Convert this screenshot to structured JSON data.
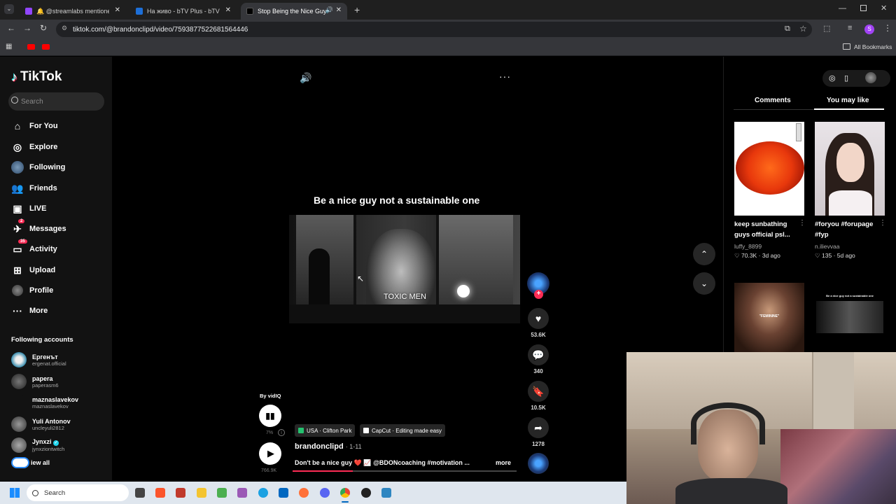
{
  "browser": {
    "tabs": [
      {
        "title": "🔔 @streamlabs mentioned yo",
        "fav_color": "#9146ff"
      },
      {
        "title": "На живо - bTV Plus - bTV+",
        "fav_color": "#1d6fd8"
      },
      {
        "title": "Stop Being the Nice Guy: E",
        "fav_color": "#000000"
      }
    ],
    "url": "tiktok.com/@brandonclipd/video/7593877522681564446",
    "bookmarks_label": "All Bookmarks",
    "profile_initial": "S"
  },
  "tiktok": {
    "logo": "TikTok",
    "search_placeholder": "Search",
    "nav": [
      {
        "label": "For You",
        "icon": "home-icon"
      },
      {
        "label": "Explore",
        "icon": "compass-icon"
      },
      {
        "label": "Following",
        "icon": "following-avatar-icon"
      },
      {
        "label": "Friends",
        "icon": "friends-icon"
      },
      {
        "label": "LIVE",
        "icon": "live-icon"
      },
      {
        "label": "Messages",
        "icon": "messages-icon",
        "badge": "2"
      },
      {
        "label": "Activity",
        "icon": "activity-icon",
        "badge": "35"
      },
      {
        "label": "Upload",
        "icon": "upload-icon"
      },
      {
        "label": "Profile",
        "icon": "profile-icon"
      },
      {
        "label": "More",
        "icon": "more-icon"
      }
    ],
    "following_heading": "Following accounts",
    "following": [
      {
        "name": "Ергенът",
        "handle": "ergenat.official"
      },
      {
        "name": "papera",
        "handle": "paperasm6"
      },
      {
        "name": "maznaslavekov",
        "handle": "maznaslavekov"
      },
      {
        "name": "Yuli Antonov",
        "handle": "uncleyuli2812"
      },
      {
        "name": "Jynxzi",
        "handle": "jynxziontwitch"
      }
    ],
    "see_all": "iew all"
  },
  "video": {
    "headline": "Be a nice guy not a sustainable one",
    "overlay_text": "TOXIC MEN",
    "by_label": "By vidIQ",
    "vidiq_pct": "7%",
    "views": "766.9K",
    "location_tag": "USA · Clifton Park",
    "capcut_tag": "CapCut · Editing made easy",
    "author": "brandonclipd",
    "date": "· 1-11",
    "description": "Don't be a nice guy ❤️ 📈 @BDONcoaching #motivation ...",
    "more_label": "more",
    "progress": 0.27,
    "likes": "53.6K",
    "comments": "340",
    "saves": "10.5K",
    "shares": "1278"
  },
  "right_panel": {
    "tabs": [
      "Comments",
      "You may like"
    ],
    "active_tab": "You may like",
    "videos": [
      {
        "caption": "keep sunbathing guys official psl...",
        "author": "luffy_8899",
        "likes": "70.3K",
        "age": "3d ago"
      },
      {
        "caption": "#foryou #forupage #fyp",
        "author": "n.ilievvaa",
        "likes": "135",
        "age": "5d ago"
      },
      {
        "caption": "",
        "author": "",
        "likes": "",
        "age": "",
        "overlay": "\"FEMININE\""
      },
      {
        "caption": "",
        "author": "",
        "likes": "",
        "age": "",
        "overlay": "Be a nice guy not a sustainable one"
      }
    ]
  },
  "taskbar": {
    "search_label": "Search"
  }
}
